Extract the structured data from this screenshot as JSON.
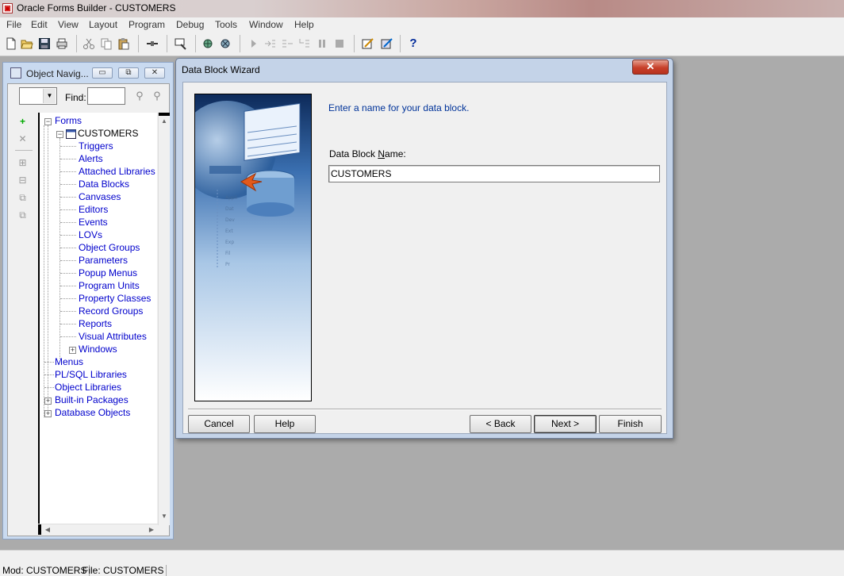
{
  "window": {
    "title": "Oracle Forms Builder - CUSTOMERS"
  },
  "menu": [
    "File",
    "Edit",
    "View",
    "Layout",
    "Program",
    "Debug",
    "Tools",
    "Window",
    "Help"
  ],
  "navigator": {
    "title": "Object Navig...",
    "find_label": "Find:",
    "find_value": "",
    "combo_value": "",
    "tree": {
      "root": "Forms",
      "module": "CUSTOMERS",
      "children": [
        "Triggers",
        "Alerts",
        "Attached Libraries",
        "Data Blocks",
        "Canvases",
        "Editors",
        "Events",
        "LOVs",
        "Object Groups",
        "Parameters",
        "Popup Menus",
        "Program Units",
        "Property Classes",
        "Record Groups",
        "Reports",
        "Visual Attributes",
        "Windows"
      ],
      "top_level": [
        "Menus",
        "PL/SQL Libraries",
        "Object Libraries",
        "Built-in Packages",
        "Database Objects"
      ]
    }
  },
  "dialog": {
    "title": "Data Block Wizard",
    "prompt": "Enter a name for your data block.",
    "field_label_pre": "Data Block ",
    "field_label_accel": "N",
    "field_label_post": "ame:",
    "field_value": "CUSTOMERS",
    "buttons": {
      "cancel": "Cancel",
      "help": "Help",
      "back": "< Back",
      "next": "Next >",
      "finish": "Finish"
    }
  },
  "status": {
    "module": "Mod: CUSTOMERS",
    "file": "File: CUSTOMERS"
  },
  "colors": {
    "tree_link": "#0000cc",
    "prompt_text": "#003399",
    "workspace": "#ababab",
    "close_button": "#c7402a"
  }
}
